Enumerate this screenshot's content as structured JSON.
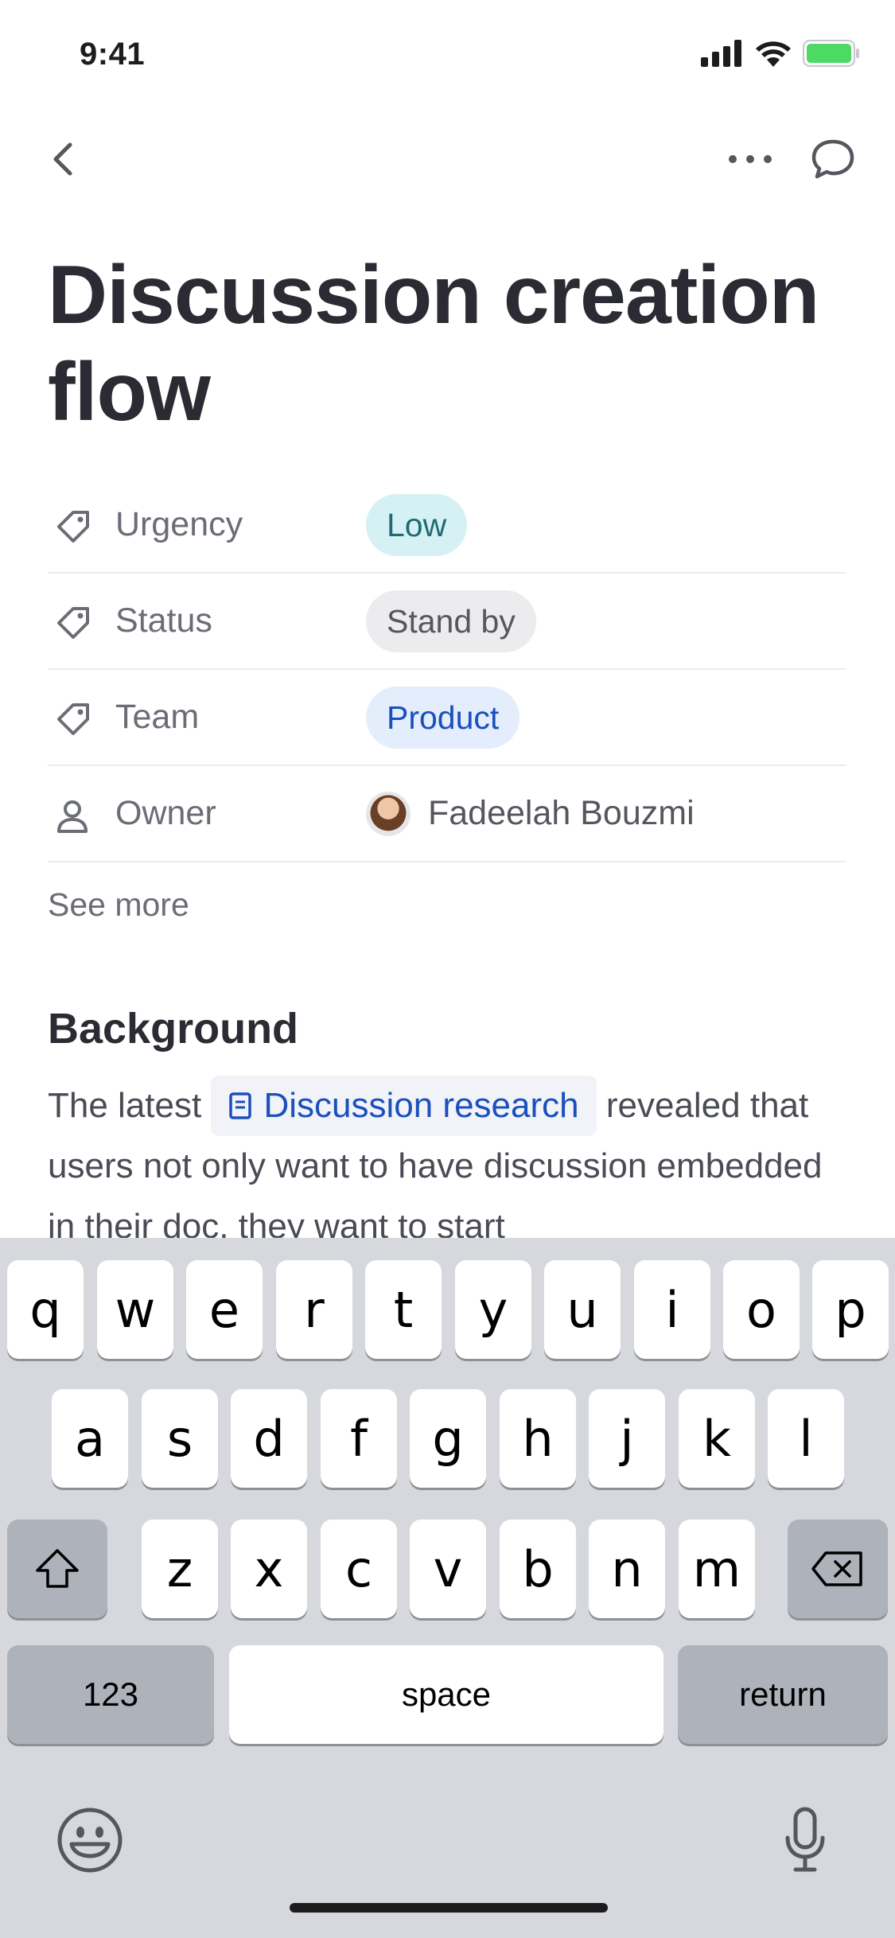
{
  "status_bar": {
    "time": "9:41",
    "icons": [
      "signal-icon",
      "wifi-icon",
      "battery-icon"
    ]
  },
  "nav": {
    "back_icon": "chevron-left-icon",
    "more_icon": "ellipsis-icon",
    "comment_icon": "comment-bubble-icon"
  },
  "page": {
    "title": "Discussion creation flow"
  },
  "properties": [
    {
      "icon": "tag-icon",
      "label": "Urgency",
      "value": "Low",
      "style": "teal"
    },
    {
      "icon": "tag-icon",
      "label": "Status",
      "value": "Stand by",
      "style": "gray"
    },
    {
      "icon": "tag-icon",
      "label": "Team",
      "value": "Product",
      "style": "blue"
    },
    {
      "icon": "person-icon",
      "label": "Owner",
      "value": "Fadeelah Bouzmi",
      "style": "owner"
    }
  ],
  "see_more": "See more",
  "background": {
    "heading": "Background",
    "text_before": "The latest",
    "link_text": "Discussion research",
    "text_after": "revealed that users not only want to have discussion embedded in their doc, they want to start"
  },
  "keyboard": {
    "row1": [
      "q",
      "w",
      "e",
      "r",
      "t",
      "y",
      "u",
      "i",
      "o",
      "p"
    ],
    "row2": [
      "a",
      "s",
      "d",
      "f",
      "g",
      "h",
      "j",
      "k",
      "l"
    ],
    "row3": [
      "z",
      "x",
      "c",
      "v",
      "b",
      "n",
      "m"
    ],
    "numbers_label": "123",
    "space_label": "space",
    "return_label": "return"
  },
  "colors": {
    "chip_teal_bg": "#d6f1f3",
    "chip_gray_bg": "#ececee",
    "chip_blue_bg": "#e3edfc",
    "link_blue": "#1a4fbe",
    "keyboard_bg": "#d6d8de"
  }
}
